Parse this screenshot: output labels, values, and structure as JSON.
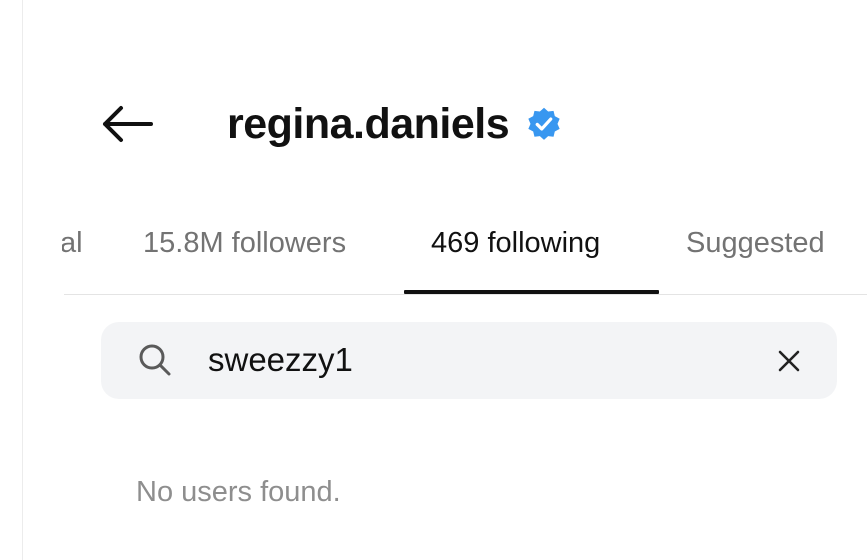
{
  "header": {
    "title": "regina.daniels",
    "verified": true,
    "back_icon": "arrow-left-icon",
    "verified_icon": "verified-badge-icon"
  },
  "tabs": [
    {
      "label": "al",
      "active": false
    },
    {
      "label": "15.8M followers",
      "active": false
    },
    {
      "label": "469 following",
      "active": true
    },
    {
      "label": "Suggested",
      "active": false
    }
  ],
  "search": {
    "value": "sweezzy1",
    "icon": "search-icon",
    "clear_icon": "close-icon"
  },
  "results": {
    "empty_message": "No users found."
  },
  "colors": {
    "text_primary": "#111111",
    "text_secondary": "#737373",
    "text_muted": "#8e8e8e",
    "verified_blue": "#3897f0",
    "search_bg": "#f3f4f6",
    "divider": "#e4e4e4"
  }
}
